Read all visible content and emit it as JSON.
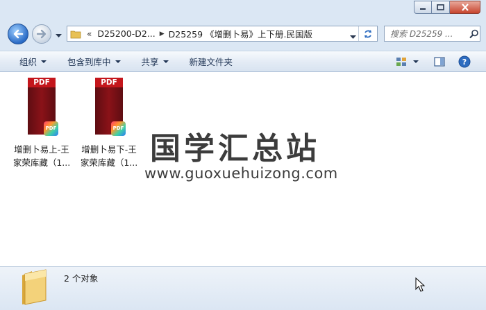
{
  "window": {
    "minimize_icon": "minimize-icon",
    "maximize_icon": "maximize-icon",
    "close_icon": "close-icon"
  },
  "nav": {
    "back_icon": "back-arrow-icon",
    "forward_icon": "forward-arrow-icon"
  },
  "address": {
    "overflow": "«",
    "crumbs": [
      "D25200-D2...",
      "D25259 《增删卜易》上下册.民国版"
    ]
  },
  "search": {
    "placeholder": "搜索 D25259 ..."
  },
  "toolbar": {
    "organize": "组织",
    "include_library": "包含到库中",
    "share": "共享",
    "new_folder": "新建文件夹"
  },
  "files": [
    {
      "line1": "增删卜易上-王",
      "line2": "家荣库藏（1...",
      "icon": "pdf-file-icon",
      "header": "PDF",
      "badge": "PDF"
    },
    {
      "line1": "增删卜易下-王",
      "line2": "家荣库藏（1...",
      "icon": "pdf-file-icon",
      "header": "PDF",
      "badge": "PDF"
    }
  ],
  "watermark": {
    "chinese": "国学汇总站",
    "url": "www.guoxuehuizong.com"
  },
  "details": {
    "count_text": "2 个对象"
  },
  "colors": {
    "accent": "#2a6bc6",
    "pdf_red": "#c4161c",
    "close_red": "#c7442d"
  }
}
